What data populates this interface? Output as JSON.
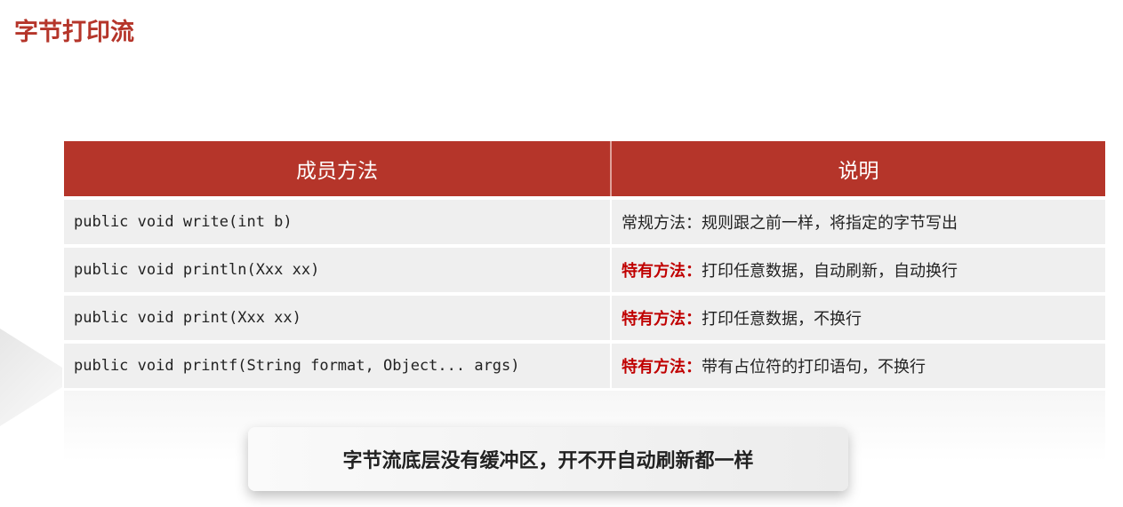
{
  "title": "字节打印流",
  "table": {
    "headers": [
      "成员方法",
      "说明"
    ],
    "rows": [
      {
        "method": "public void write(int b)",
        "tag": "",
        "desc": "常规方法：规则跟之前一样，将指定的字节写出"
      },
      {
        "method": "public void println(Xxx xx)",
        "tag": "特有方法：",
        "desc": "打印任意数据，自动刷新，自动换行"
      },
      {
        "method": "public void print(Xxx xx)",
        "tag": "特有方法：",
        "desc": "打印任意数据，不换行"
      },
      {
        "method": "public void printf(String format, Object... args)",
        "tag": "特有方法：",
        "desc": "带有占位符的打印语句，不换行"
      }
    ]
  },
  "note": "字节流底层没有缓冲区，开不开自动刷新都一样"
}
